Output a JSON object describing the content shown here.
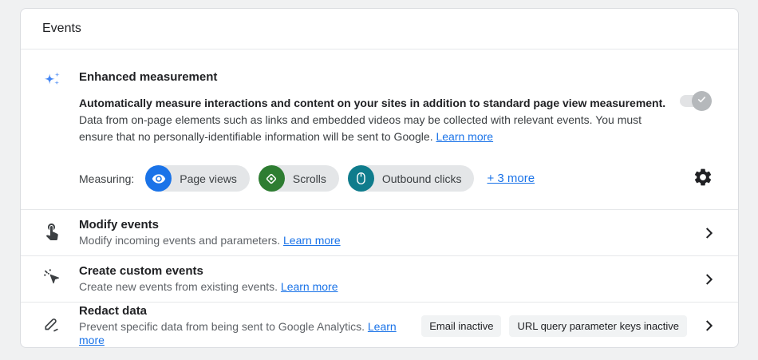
{
  "header": {
    "title": "Events"
  },
  "enhanced_measurement": {
    "title": "Enhanced measurement",
    "description_bold": "Automatically measure interactions and content on your sites in addition to standard page view measurement.",
    "description_rest": "Data from on-page elements such as links and embedded videos may be collected with relevant events. You must ensure that no personally-identifiable information will be sent to Google.",
    "learn_more": "Learn more",
    "toggle_state": "on-disabled",
    "measuring_label": "Measuring:",
    "chips": [
      {
        "label": "Page views",
        "icon": "eye-icon",
        "color": "#1a73e8"
      },
      {
        "label": "Scrolls",
        "icon": "scroll-diamond-icon",
        "color": "#2e7d32"
      },
      {
        "label": "Outbound clicks",
        "icon": "mouse-icon",
        "color": "#0f7c8c"
      }
    ],
    "more_link": "+ 3 more"
  },
  "rows": [
    {
      "title": "Modify events",
      "description": "Modify incoming events and parameters.",
      "learn_more": "Learn more",
      "icon": "touch-icon",
      "badges": []
    },
    {
      "title": "Create custom events",
      "description": "Create new events from existing events.",
      "learn_more": "Learn more",
      "icon": "cursor-click-icon",
      "badges": []
    },
    {
      "title": "Redact data",
      "description": "Prevent specific data from being sent to Google Analytics.",
      "learn_more": "Learn more",
      "icon": "redact-pencil-icon",
      "badges": [
        "Email inactive",
        "URL query parameter keys inactive"
      ]
    }
  ],
  "colors": {
    "accent_link": "#1a73e8",
    "chip_background": "#e4e6e8",
    "badge_background": "#f1f3f4",
    "page_background": "#f0f1f2",
    "sparkle_blue": "#4285f4"
  }
}
